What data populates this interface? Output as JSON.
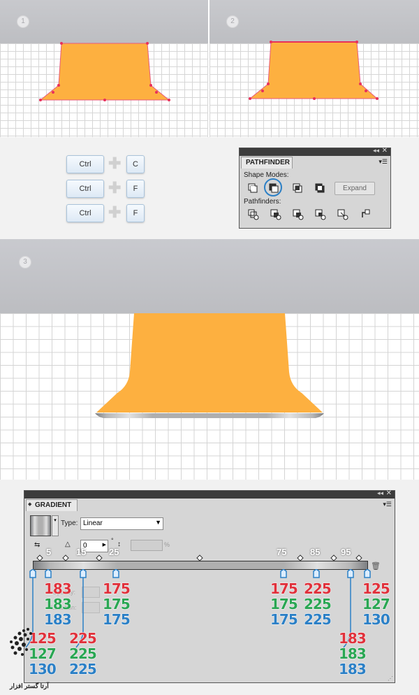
{
  "steps": {
    "s1": "1",
    "s2": "2",
    "s3": "3"
  },
  "shortcuts": [
    {
      "mod": "Ctrl",
      "key": "C"
    },
    {
      "mod": "Ctrl",
      "key": "F"
    },
    {
      "mod": "Ctrl",
      "key": "F"
    }
  ],
  "pathfinder": {
    "title": "PATHFINDER",
    "shape_modes_label": "Shape Modes:",
    "expand_label": "Expand",
    "pathfinders_label": "Pathfinders:"
  },
  "gradient": {
    "title": "GRADIENT",
    "type_label": "Type:",
    "type_value": "Linear",
    "angle_value": "0",
    "percent": "%",
    "opacity_label": "Opacity:",
    "location_label": "Location:",
    "positions": [
      "5",
      "15",
      "25",
      "75",
      "85",
      "95"
    ],
    "stops": [
      {
        "r": "125",
        "g": "127",
        "b": "130"
      },
      {
        "r": "183",
        "g": "183",
        "b": "183"
      },
      {
        "r": "225",
        "g": "225",
        "b": "225"
      },
      {
        "r": "175",
        "g": "175",
        "b": "175"
      },
      {
        "r": "175",
        "g": "175",
        "b": "175"
      },
      {
        "r": "225",
        "g": "225",
        "b": "225"
      },
      {
        "r": "183",
        "g": "183",
        "b": "183"
      },
      {
        "r": "125",
        "g": "127",
        "b": "130"
      }
    ]
  },
  "watermark": "آرتا گستر افزار",
  "colors": {
    "shape": "#fdb040",
    "accent_red": "#e0323c",
    "accent_green": "#2aa653",
    "accent_blue": "#2c80c6"
  }
}
